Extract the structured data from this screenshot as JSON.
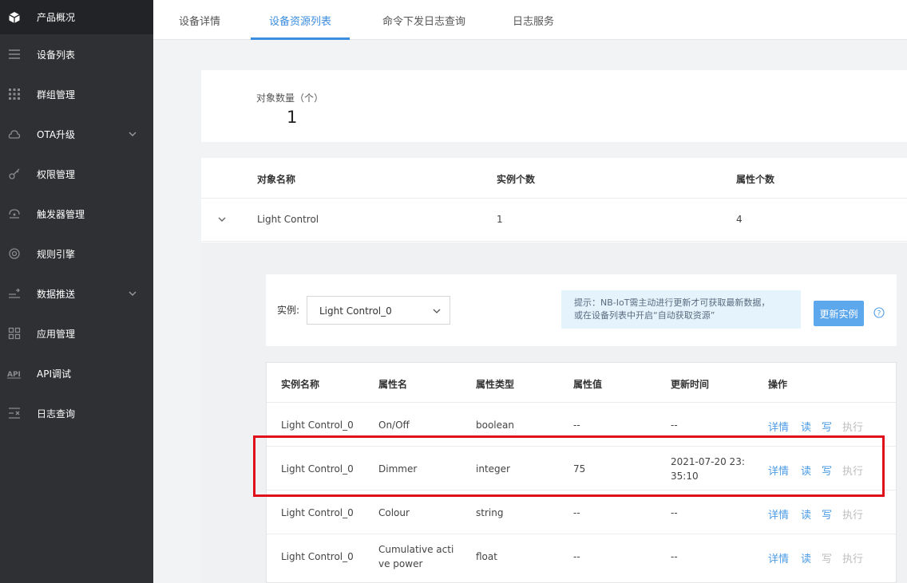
{
  "sidebar": {
    "items": [
      {
        "label": "产品概况",
        "icon": "cube-icon"
      },
      {
        "label": "设备列表",
        "icon": "list-icon"
      },
      {
        "label": "群组管理",
        "icon": "grid-dots-icon"
      },
      {
        "label": "OTA升级",
        "icon": "cloud-upgrade-icon"
      },
      {
        "label": "权限管理",
        "icon": "key-icon"
      },
      {
        "label": "触发器管理",
        "icon": "trigger-icon"
      },
      {
        "label": "规则引擎",
        "icon": "engine-icon"
      },
      {
        "label": "数据推送",
        "icon": "push-icon"
      },
      {
        "label": "应用管理",
        "icon": "apps-icon"
      },
      {
        "label": "API调试",
        "icon": "api-icon"
      },
      {
        "label": "日志查询",
        "icon": "log-icon"
      }
    ]
  },
  "tabs": [
    {
      "label": "设备详情"
    },
    {
      "label": "设备资源列表"
    },
    {
      "label": "命令下发日志查询"
    },
    {
      "label": "日志服务"
    }
  ],
  "count": {
    "label": "对象数量（个）",
    "value": "1"
  },
  "object_table": {
    "headers": [
      "对象名称",
      "实例个数",
      "属性个数"
    ],
    "row": {
      "name": "Light Control",
      "instances": "1",
      "attributes": "4"
    }
  },
  "instance": {
    "label": "实例:",
    "selected": "Light Control_0",
    "tip_line1": "提示：NB-IoT需主动进行更新才可获取最新数据，",
    "tip_line2": "或在设备列表中开启“自动获取资源”",
    "update_button": "更新实例"
  },
  "attr_table": {
    "headers": [
      "实例名称",
      "属性名",
      "属性类型",
      "属性值",
      "更新时间",
      "操作"
    ],
    "actions": {
      "detail": "详情",
      "read": "读",
      "write": "写",
      "execute": "执行"
    },
    "rows": [
      {
        "instance": "Light Control_0",
        "name": "On/Off",
        "name2": "",
        "type": "boolean",
        "value": "--",
        "time1": "--",
        "time2": ""
      },
      {
        "instance": "Light Control_0",
        "name": "Dimmer",
        "name2": "",
        "type": "integer",
        "value": "75",
        "time1": "2021-07-20 23:",
        "time2": "35:10"
      },
      {
        "instance": "Light Control_0",
        "name": "Colour",
        "name2": "",
        "type": "string",
        "value": "--",
        "time1": "--",
        "time2": ""
      },
      {
        "instance": "Light Control_0",
        "name": "Cumulative acti",
        "name2": "ve power",
        "type": "float",
        "value": "--",
        "time1": "--",
        "time2": ""
      }
    ]
  },
  "colors": {
    "accent": "#3b8de0",
    "sidebar_bg": "#2f3033",
    "highlight": "#e0101a"
  }
}
